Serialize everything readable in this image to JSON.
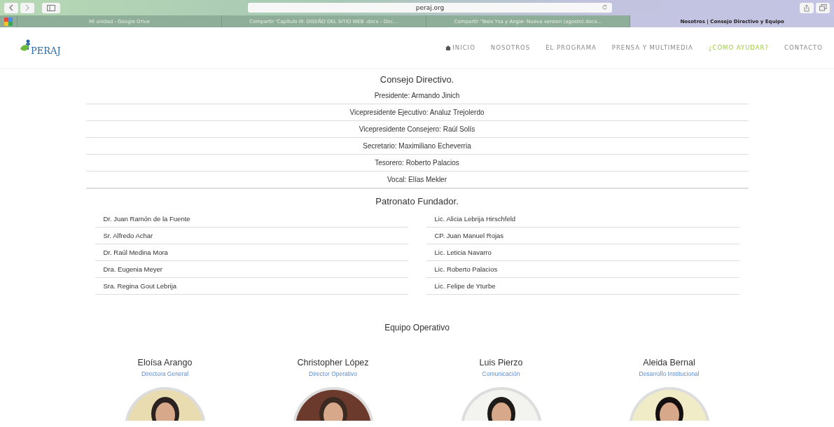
{
  "browser": {
    "address": "peraj.org",
    "tabs": [
      {
        "title": "Mi unidad - Google Drive",
        "selected": false
      },
      {
        "title": "Compartir 'Capítulo III: DISEÑO DEL SITIO WEB .docx - Doc...",
        "selected": false
      },
      {
        "title": "Compartir 'Tesis Ysa y Angie- Nueva version (agosto).docx...",
        "selected": false
      },
      {
        "title": "Nosotros | Consejo Directivo y Equipo",
        "selected": true
      }
    ]
  },
  "site": {
    "logo": "PERAJ",
    "nav": [
      {
        "label": "INICIO",
        "kind": "home",
        "highlighted": false
      },
      {
        "label": "NOSOTROS",
        "kind": "link",
        "highlighted": false
      },
      {
        "label": "EL PROGRAMA",
        "kind": "link",
        "highlighted": false
      },
      {
        "label": "PRENSA Y MULTIMEDIA",
        "kind": "link",
        "highlighted": false
      },
      {
        "label": "¿CÓMO AYUDAR?",
        "kind": "link",
        "highlighted": true
      },
      {
        "label": "CONTACTO",
        "kind": "link",
        "highlighted": false
      }
    ]
  },
  "board": {
    "title": "Consejo Directivo.",
    "rows": [
      "Presidente: Armando Jinich",
      "Vicepresidente Ejecutivo: Analuz Trejolerdo",
      "Vicepresidente Consejero: Raúl Solís",
      "Secretario: Maximiliano Echeverria",
      "Tesorero: Roberto Palacios",
      "Vocal: Elías Mekler"
    ]
  },
  "founders": {
    "title": "Patronato Fundador.",
    "left": [
      "Dr. Juan Ramón de la Fuente",
      "Sr. Alfredo Achar",
      "Dr. Raúl Medina Mora",
      "Dra. Eugenia Meyer",
      "Sra. Regina Gout Lebrija"
    ],
    "right": [
      "Lic. Alicia Lebrija Hirschfeld",
      "CP. Juan Manuel Rojas",
      "Lic. Leticia Navarro",
      "Lic. Roberto Palacios",
      "Lic. Felipe de Yturbe"
    ]
  },
  "team": {
    "title": "Equipo Operativo",
    "members": [
      {
        "name": "Eloísa Arango",
        "role": "Directora General",
        "kind": "picture"
      },
      {
        "name": "Christopher López",
        "role": "Director Operativo",
        "kind": "picture"
      },
      {
        "name": "Luis Pierzo",
        "role": "Comunicación",
        "kind": "picture"
      },
      {
        "name": "Aleida Bernal",
        "role": "Desarrollo Institucional",
        "kind": "picture"
      }
    ]
  }
}
